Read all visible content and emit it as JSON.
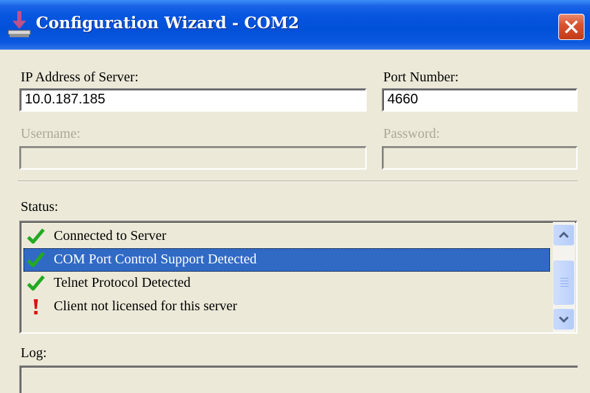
{
  "window": {
    "title": "Configuration Wizard - COM2",
    "icon": "download-arrow-icon",
    "close_icon": "close-icon"
  },
  "server": {
    "ip_label": "IP Address of Server:",
    "ip_value": "10.0.187.185",
    "port_label": "Port Number:",
    "port_value": "4660"
  },
  "auth": {
    "username_label": "Username:",
    "username_value": "",
    "password_label": "Password:",
    "password_value": ""
  },
  "status": {
    "label": "Status:",
    "items": [
      {
        "text": "Connected to Server",
        "icon": "checkmark-icon",
        "selected": false
      },
      {
        "text": "COM Port Control Support Detected",
        "icon": "checkmark-icon",
        "selected": true
      },
      {
        "text": "Telnet Protocol Detected",
        "icon": "checkmark-icon",
        "selected": false
      },
      {
        "text": "Client not licensed for this server",
        "icon": "exclamation-icon",
        "selected": false
      }
    ],
    "selection_color": "#316ac5",
    "check_color": "#22aa22",
    "warning_color": "#e01010"
  },
  "log": {
    "label": "Log:"
  }
}
